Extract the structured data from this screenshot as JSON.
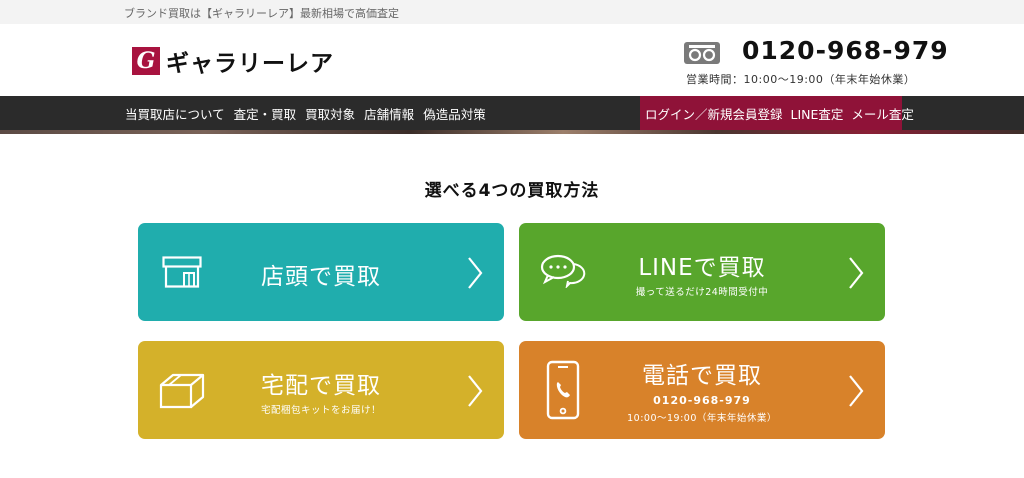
{
  "topbar": {
    "text": "ブランド買取は【ギャラリーレア】最新相場で高価査定"
  },
  "header": {
    "logo_mark": "G",
    "logo_text": "ギャラリーレア",
    "phone_number": "0120-968-979",
    "phone_hours": "営業時間：10:00～19:00（年末年始休業）"
  },
  "nav": {
    "left": [
      "当買取店について",
      "査定・買取",
      "買取対象",
      "店舗情報",
      "偽造品対策"
    ],
    "right": [
      "ログイン／新規会員登録",
      "LINE査定",
      "メール査定"
    ]
  },
  "section": {
    "title": "選べる4つの買取方法"
  },
  "cards": {
    "store": {
      "title": "店頭で買取",
      "color": "#20adad",
      "icon": "store-icon"
    },
    "line": {
      "title": "LINEで買取",
      "subtitle": "撮って送るだけ24時間受付中",
      "color": "#58a62c",
      "icon": "chat-bubbles-icon"
    },
    "delivery": {
      "title": "宅配で買取",
      "subtitle": "宅配梱包キットをお届け！",
      "color": "#d4b12a",
      "icon": "box-icon"
    },
    "phone": {
      "title": "電話で買取",
      "number": "0120-968-979",
      "hours": "10:00～19:00（年末年始休業）",
      "color": "#d8822a",
      "icon": "smartphone-icon"
    }
  },
  "colors": {
    "accent": "#8f1238",
    "nav_bg": "#2b2b2b",
    "logo": "#a8133f"
  }
}
